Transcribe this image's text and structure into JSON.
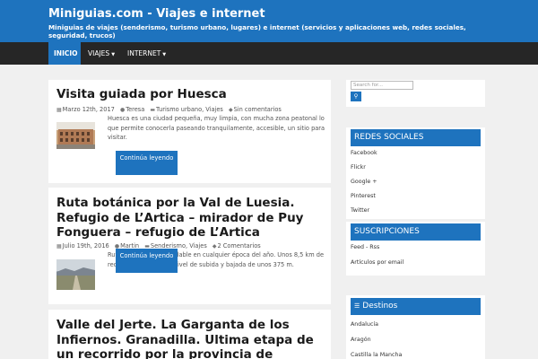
{
  "header": {
    "site_title": "Miniguias.com - Viajes e internet",
    "site_description": "Miniguias de viajes (senderismo, turismo urbano, lugares) e internet (servicios y aplicaciones web, redes sociales, seguridad, trucos)"
  },
  "nav": {
    "items": [
      {
        "label": "INICIO",
        "active": true,
        "dropdown": false
      },
      {
        "label": "VIAJES",
        "active": false,
        "dropdown": true
      },
      {
        "label": "INTERNET",
        "active": false,
        "dropdown": true
      }
    ]
  },
  "posts": [
    {
      "title": "Visita guiada por Huesca",
      "date": "Marzo 12th, 2017",
      "author": "Teresa",
      "categories": "Turismo urbano, Viajes",
      "comments": "Sin comentarios",
      "excerpt": "Huesca es una ciudad pequeña, muy limpia, con mucha zona peatonal lo que permite conocerla paseando tranquilamente, accesible, un sitio para visitar.",
      "button": "Continúa leyendo"
    },
    {
      "title": "Ruta botánica por la Val de Luesia. Refugio de L’Artica – mirador de Puy Fonguera – refugio de L’Artica",
      "date": "Julio 19th, 2016",
      "author": "Martin",
      "categories": "Senderismo, Viajes",
      "comments": "2 Comentarios",
      "excerpt": "Ruta circular muy agradable en cualquier época del año. Unos 8,5 km de recorrido y con un desnivel de subida y bajada de unos 375 m.",
      "button": "Continúa leyendo"
    },
    {
      "title": "Valle del Jerte. La Garganta de los Infiernos. Granadilla. Ultima etapa de un recorrido por la provincia de Cáceres"
    }
  ],
  "sidebar": {
    "search_placeholder": "Search for...",
    "redes": {
      "title": "REDES SOCIALES",
      "links": [
        "Facebook",
        "Flickr",
        "Google +",
        "Pinterest",
        "Twitter"
      ]
    },
    "suscripciones": {
      "title": "SUSCRIPCIONES",
      "links": [
        "Feed - Rss",
        "Artículos por email"
      ]
    },
    "destinos": {
      "title": "Destinos",
      "links": [
        "Andalucía",
        "Aragón",
        "Castilla la Mancha"
      ]
    }
  },
  "colors": {
    "brand": "#1e73be",
    "nav_bg": "#262626",
    "page_bg": "#f0f0f0"
  }
}
